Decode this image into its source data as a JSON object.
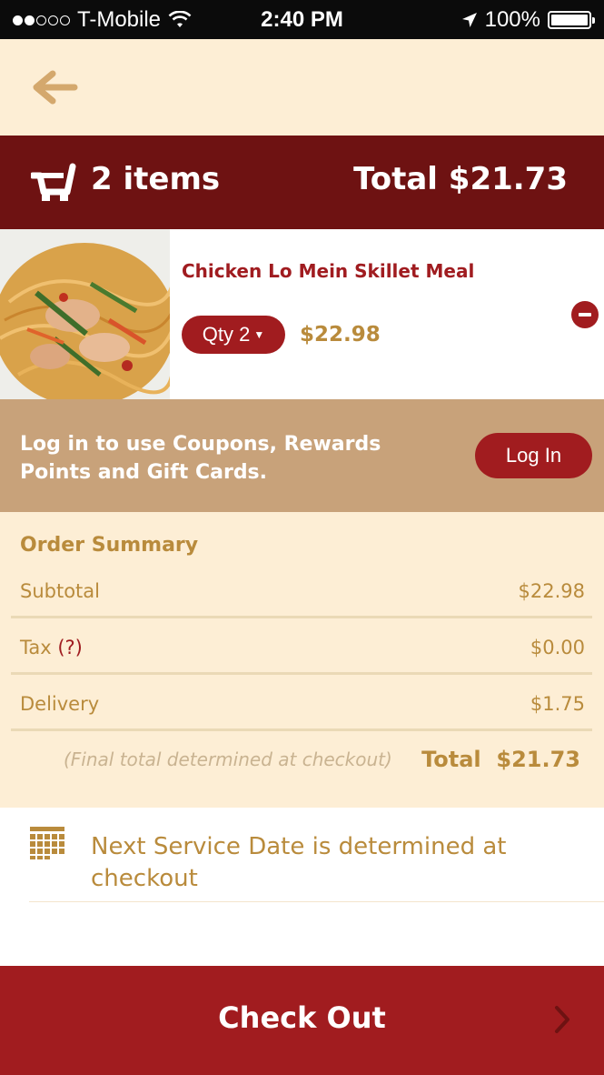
{
  "status_bar": {
    "carrier": "T-Mobile",
    "time": "2:40 PM",
    "battery": "100%",
    "signal_bars": 2,
    "signal_total": 5
  },
  "nav": {
    "back_icon": "back-arrow-icon"
  },
  "cart": {
    "items_label": "2 items",
    "total_label": "Total $21.73"
  },
  "item": {
    "name": "Chicken Lo Mein Skillet Meal",
    "qty_label": "Qty 2",
    "price": "$22.98"
  },
  "login": {
    "message": "Log in to use Coupons, Rewards Points and Gift Cards.",
    "button": "Log In"
  },
  "summary": {
    "title": "Order Summary",
    "rows": [
      {
        "label": "Subtotal",
        "value": "$22.98"
      },
      {
        "label": "Tax",
        "help": "(?)",
        "value": "$0.00"
      },
      {
        "label": "Delivery",
        "value": "$1.75"
      }
    ],
    "note": "(Final total determined at checkout)",
    "total_label": "Total",
    "total_value": "$21.73"
  },
  "service": {
    "text": "Next Service Date is determined at checkout"
  },
  "checkout": {
    "label": "Check Out"
  },
  "colors": {
    "maroon": "#6e1212",
    "red": "#a11c1f",
    "gold": "#b98b3c",
    "tan": "#c8a27a",
    "cream": "#fdeed5"
  }
}
